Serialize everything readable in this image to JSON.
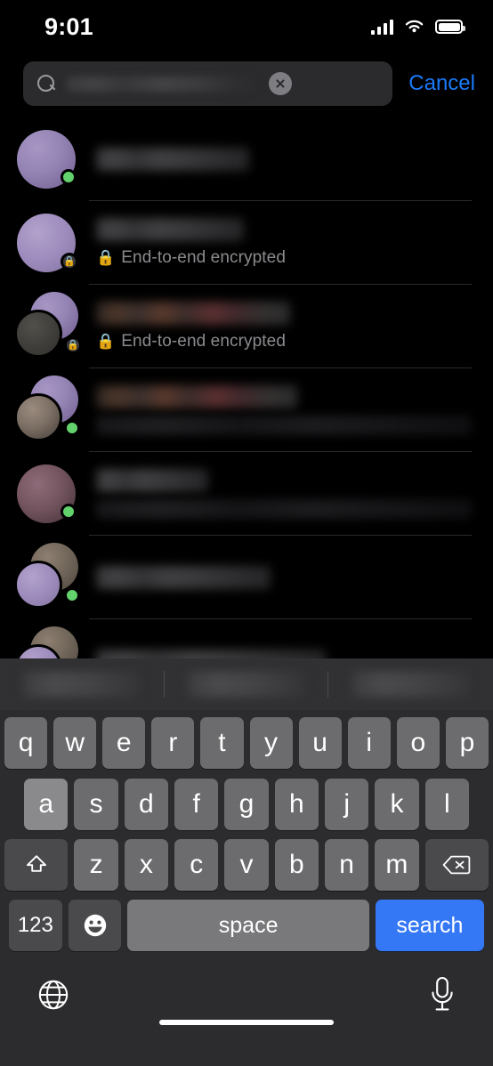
{
  "status_bar": {
    "time": "9:01",
    "cellular_icon": "cellular-bars-icon",
    "wifi_icon": "wifi-icon",
    "battery_icon": "battery-full-icon"
  },
  "search": {
    "search_icon": "search-icon",
    "value": "",
    "placeholder": "",
    "blurred_query_text": "",
    "clear_icon": "clear-circle-icon",
    "cancel_label": "Cancel"
  },
  "chat_list": {
    "encrypted_label": "End-to-end encrypted",
    "lock_glyph": "🔒",
    "rows": [
      {
        "avatar": "single-purple",
        "badge": "online",
        "name_blurred": "",
        "subtitle_type": "none",
        "preview_blurred": ""
      },
      {
        "avatar": "single-purple",
        "badge": "lock",
        "name_blurred": "",
        "subtitle_type": "encrypted",
        "preview_blurred": ""
      },
      {
        "avatar": "group-dark-purple",
        "badge": "lock",
        "name_blurred": "",
        "subtitle_type": "encrypted",
        "preview_blurred": ""
      },
      {
        "avatar": "group-brown-purple",
        "badge": "online",
        "name_blurred": "",
        "subtitle_type": "preview",
        "preview_blurred": ""
      },
      {
        "avatar": "single-red",
        "badge": "online",
        "name_blurred": "",
        "subtitle_type": "preview",
        "preview_blurred": ""
      },
      {
        "avatar": "group-purple-brown",
        "badge": "online",
        "name_blurred": "",
        "subtitle_type": "none",
        "preview_blurred": ""
      },
      {
        "avatar": "group-brown-purple",
        "badge": "none",
        "name_blurred": "",
        "subtitle_type": "none",
        "preview_blurred": ""
      }
    ]
  },
  "keyboard": {
    "suggestions": [
      "",
      "",
      ""
    ],
    "row1": [
      "q",
      "w",
      "e",
      "r",
      "t",
      "y",
      "u",
      "i",
      "o",
      "p"
    ],
    "row2": [
      "a",
      "s",
      "d",
      "f",
      "g",
      "h",
      "j",
      "k",
      "l"
    ],
    "row3": [
      "z",
      "x",
      "c",
      "v",
      "b",
      "n",
      "m"
    ],
    "shift_icon": "shift-arrow-icon",
    "backspace_icon": "backspace-delete-icon",
    "numbers_label": "123",
    "emoji_icon": "emoji-smiley-icon",
    "space_label": "space",
    "search_label": "search",
    "globe_icon": "globe-language-icon",
    "dictation_icon": "microphone-icon"
  },
  "colors": {
    "background": "#000000",
    "accent_blue": "#1a7af8",
    "return_key_blue": "#3478f6",
    "online_green": "#63d26d",
    "keyboard_bg": "#2c2c2e",
    "key_gray": "#6c6c6e",
    "search_field_bg": "#2b2b2d",
    "secondary_text": "#8b8b8f"
  }
}
